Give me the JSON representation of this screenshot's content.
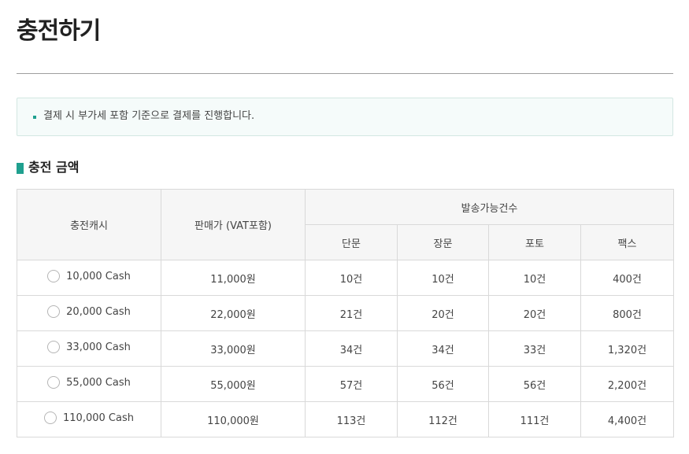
{
  "page_title": "충전하기",
  "notice": {
    "text": "결제 시 부가세 포함 기준으로 결제를 진행합니다."
  },
  "section": {
    "title": "충전 금액"
  },
  "colors": {
    "accent": "#1fa08f",
    "header_bg": "#f6f6f6",
    "notice_bg": "#f5fbfa",
    "border": "#d9d9d9"
  },
  "table": {
    "headers": {
      "cash": "충전캐시",
      "price": "판매가 (VAT포함)",
      "sendable": "발송가능건수",
      "short": "단문",
      "long": "장문",
      "photo": "포토",
      "fax": "팩스"
    },
    "rows": [
      {
        "cash": "10,000 Cash",
        "price": "11,000원",
        "short": "10건",
        "long": "10건",
        "photo": "10건",
        "fax": "400건"
      },
      {
        "cash": "20,000 Cash",
        "price": "22,000원",
        "short": "21건",
        "long": "20건",
        "photo": "20건",
        "fax": "800건"
      },
      {
        "cash": "33,000 Cash",
        "price": "33,000원",
        "short": "34건",
        "long": "34건",
        "photo": "33건",
        "fax": "1,320건"
      },
      {
        "cash": "55,000 Cash",
        "price": "55,000원",
        "short": "57건",
        "long": "56건",
        "photo": "56건",
        "fax": "2,200건"
      },
      {
        "cash": "110,000 Cash",
        "price": "110,000원",
        "short": "113건",
        "long": "112건",
        "photo": "111건",
        "fax": "4,400건"
      }
    ]
  }
}
